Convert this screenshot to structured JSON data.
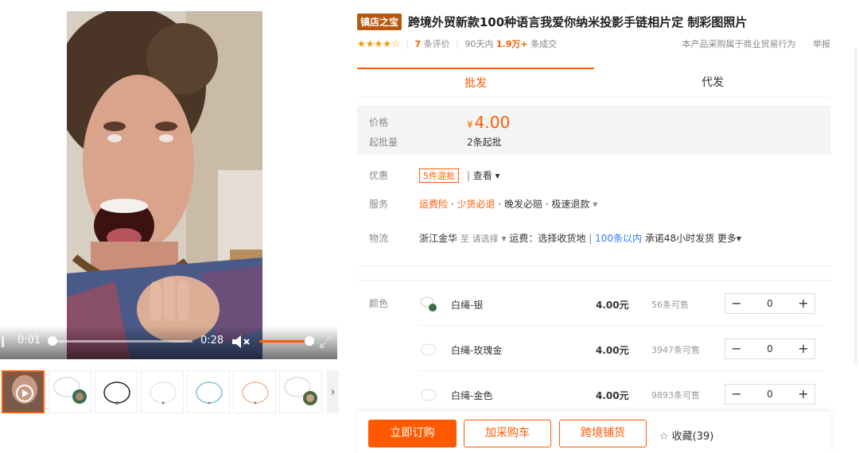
{
  "video": {
    "current_time": "0:01",
    "duration": "0:28"
  },
  "thumbnails": [
    {
      "name": "video-thumb"
    },
    {
      "name": "white-silver-thumb"
    },
    {
      "name": "black-cord-thumb"
    },
    {
      "name": "white-cord-thumb"
    },
    {
      "name": "blue-cord-thumb"
    },
    {
      "name": "pink-cord-thumb"
    },
    {
      "name": "photo-charm-thumb"
    }
  ],
  "product": {
    "badge": "镇店之宝",
    "title": "跨境外贸新款100种语言我爱你纳米投影手链相片定 制彩图照片"
  },
  "meta": {
    "stars": "★★★★",
    "star_empty": "☆",
    "review_count": "7",
    "review_label": "条评价",
    "sold_prefix": "90天内",
    "sold_count": "1.9万+",
    "sold_suffix": "条成交",
    "commercial_note": "本产品采购属于商业贸易行为",
    "report": "举报"
  },
  "tabs": {
    "wholesale": "批发",
    "dropship": "代发"
  },
  "price": {
    "label": "价格",
    "currency": "¥",
    "value": "4.00",
    "moq_label": "起批量",
    "moq_value": "2条起批"
  },
  "promo": {
    "label": "优惠",
    "tag": "5件混批",
    "view": "查看 ▾"
  },
  "service": {
    "label": "服务",
    "item1": "运费险",
    "item2": "少货必退",
    "item3": "晚发必赔",
    "item4": "极速退款",
    "more": "▾"
  },
  "logistics": {
    "label": "物流",
    "origin": "浙江金华",
    "to": "至",
    "select": "请选择",
    "chevron": "▾",
    "shipping": "运费：选择收货地",
    "qty_range": "100条以内",
    "promise": "承诺48小时发货",
    "more": "更多▾"
  },
  "sku": {
    "label": "颜色",
    "rows": [
      {
        "name": "白绳-银",
        "price": "4.00元",
        "stock": "56条可售",
        "qty": "0"
      },
      {
        "name": "白绳-玫瑰金",
        "price": "4.00元",
        "stock": "3947条可售",
        "qty": "0"
      },
      {
        "name": "白绳-金色",
        "price": "4.00元",
        "stock": "9893条可售",
        "qty": "0"
      }
    ],
    "minus": "−",
    "plus": "+"
  },
  "actions": {
    "order": "立即订购",
    "cart": "加采购车",
    "dist": "跨境铺货",
    "fav_icon": "☆",
    "fav": "收藏(39)"
  },
  "colors": {
    "accent": "#ff5a00",
    "badge": "#b8570e",
    "link": "#3377ff",
    "star": "#f39800"
  }
}
